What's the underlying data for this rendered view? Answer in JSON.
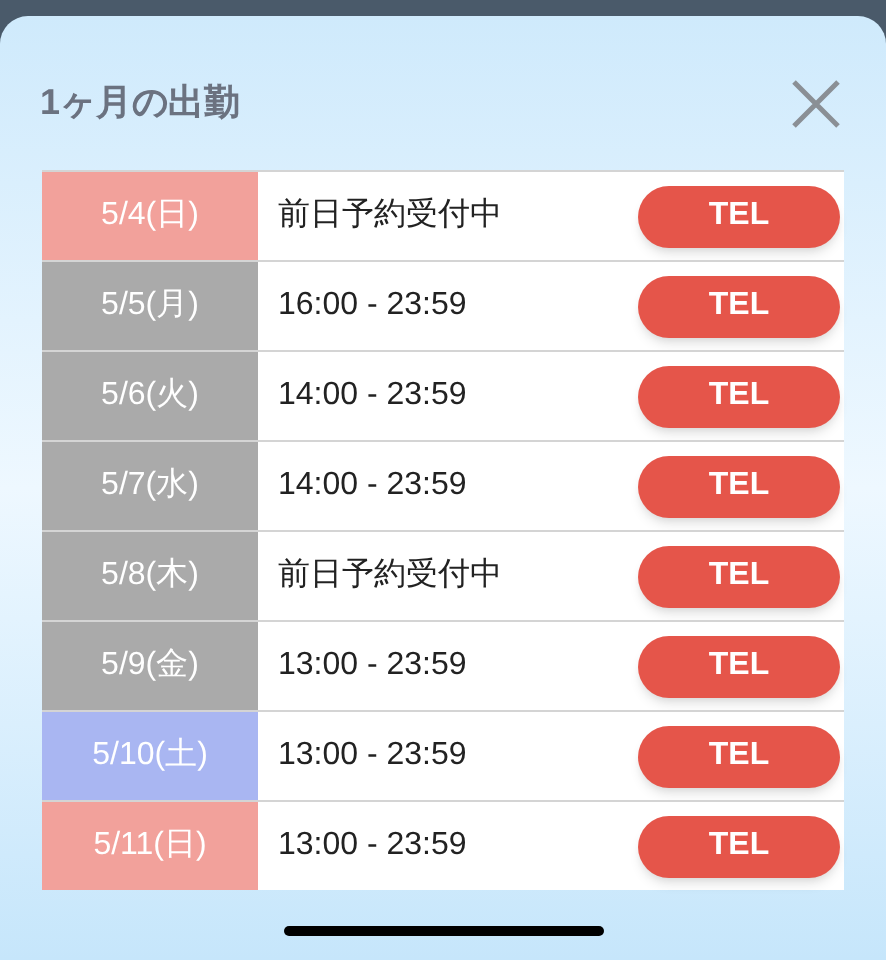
{
  "title": "1ヶ月の出勤",
  "rows": [
    {
      "date": "5/4(日)",
      "color": "#f2a19b",
      "hours": "前日予約受付中",
      "button": "TEL"
    },
    {
      "date": "5/5(月)",
      "color": "#aaaaaa",
      "hours": "16:00 - 23:59",
      "button": "TEL"
    },
    {
      "date": "5/6(火)",
      "color": "#aaaaaa",
      "hours": "14:00 - 23:59",
      "button": "TEL"
    },
    {
      "date": "5/7(水)",
      "color": "#aaaaaa",
      "hours": "14:00 - 23:59",
      "button": "TEL"
    },
    {
      "date": "5/8(木)",
      "color": "#aaaaaa",
      "hours": "前日予約受付中",
      "button": "TEL"
    },
    {
      "date": "5/9(金)",
      "color": "#aaaaaa",
      "hours": "13:00 - 23:59",
      "button": "TEL"
    },
    {
      "date": "5/10(土)",
      "color": "#a9b6f2",
      "hours": "13:00 - 23:59",
      "button": "TEL"
    },
    {
      "date": "5/11(日)",
      "color": "#f2a19b",
      "hours": "13:00 - 23:59",
      "button": "TEL"
    }
  ]
}
